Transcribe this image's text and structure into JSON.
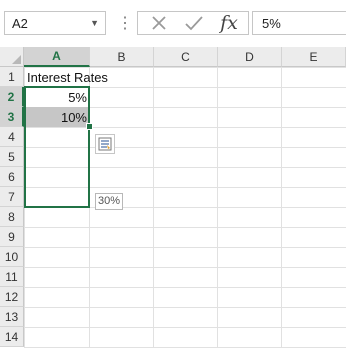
{
  "name_box": {
    "value": "A2"
  },
  "formula_bar": {
    "value": "5%",
    "fx_label": "fx"
  },
  "columns": [
    "A",
    "B",
    "C",
    "D",
    "E"
  ],
  "rows": [
    "1",
    "2",
    "3",
    "4",
    "5",
    "6",
    "7",
    "8",
    "9",
    "10",
    "11",
    "12",
    "13",
    "14"
  ],
  "cells": {
    "A1": "Interest Rates",
    "A2": "5%",
    "A3": "10%"
  },
  "fill_preview": {
    "value": "30%"
  },
  "selection": {
    "active_cell": "A2",
    "range": "A2:A7"
  },
  "colors": {
    "accent": "#217346",
    "selected_fill": "#c6c6c6"
  },
  "icons": {
    "namebox_dropdown": "chevron-down-icon",
    "cancel": "close-icon",
    "enter": "check-icon",
    "quick_analysis": "quick-analysis-icon"
  }
}
